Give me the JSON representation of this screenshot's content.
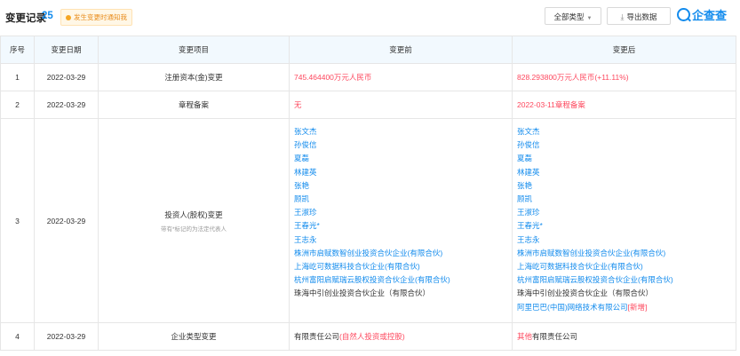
{
  "header": {
    "title": "变更记录",
    "count": "25",
    "notify_label": "发生变更时通知我",
    "type_filter_label": "全部类型",
    "export_label": "导出数据",
    "logo_text": "企查查"
  },
  "table": {
    "columns": [
      "序号",
      "变更日期",
      "变更项目",
      "变更前",
      "变更后"
    ],
    "rows": [
      {
        "index": "1",
        "date": "2022-03-29",
        "item": "注册资本(金)变更",
        "before": "745.464400万元人民币",
        "after": "828.293800万元人民币(+11.11%)"
      },
      {
        "index": "2",
        "date": "2022-03-29",
        "item": "章程备案",
        "before": "无",
        "after": "2022-03-11章程备案"
      },
      {
        "index": "3",
        "date": "2022-03-29",
        "item": "投资人(股权)变更",
        "note": "带有*标记的为法定代表人",
        "before_list": [
          "张文杰",
          "孙俊信",
          "夏磊",
          "林建英",
          "张艳",
          "顾凯",
          "王淑珍",
          "王春光*",
          "王志永",
          "株洲市启赋数智创业投资合伙企业(有限合伙)",
          "上海屹可数据科技合伙企业(有限合伙)",
          "杭州富阳启赋瑞云股权投资合伙企业(有限合伙)"
        ],
        "before_last": "珠海中引创业投资合伙企业（有限合伙）",
        "after_list": [
          "张文杰",
          "孙俊信",
          "夏磊",
          "林建英",
          "张艳",
          "顾凯",
          "王淑珍",
          "王春光*",
          "王志永",
          "株洲市启赋数智创业投资合伙企业(有限合伙)",
          "上海屹可数据科技合伙企业(有限合伙)",
          "杭州富阳启赋瑞云股权投资合伙企业(有限合伙)"
        ],
        "after_plain": "珠海中引创业投资合伙企业（有限合伙）",
        "after_new": "阿里巴巴(中国)网络技术有限公司",
        "after_new_tag": "[新增]"
      },
      {
        "index": "4",
        "date": "2022-03-29",
        "item": "企业类型变更",
        "before_plain": "有限责任公司",
        "before_red": "(自然人投资或控股)",
        "after_red": "其他",
        "after_plain": "有限责任公司"
      }
    ]
  },
  "colors": {
    "accent": "#128bed",
    "highlight": "#fd485e",
    "header_bg": "#f2f9fe"
  }
}
